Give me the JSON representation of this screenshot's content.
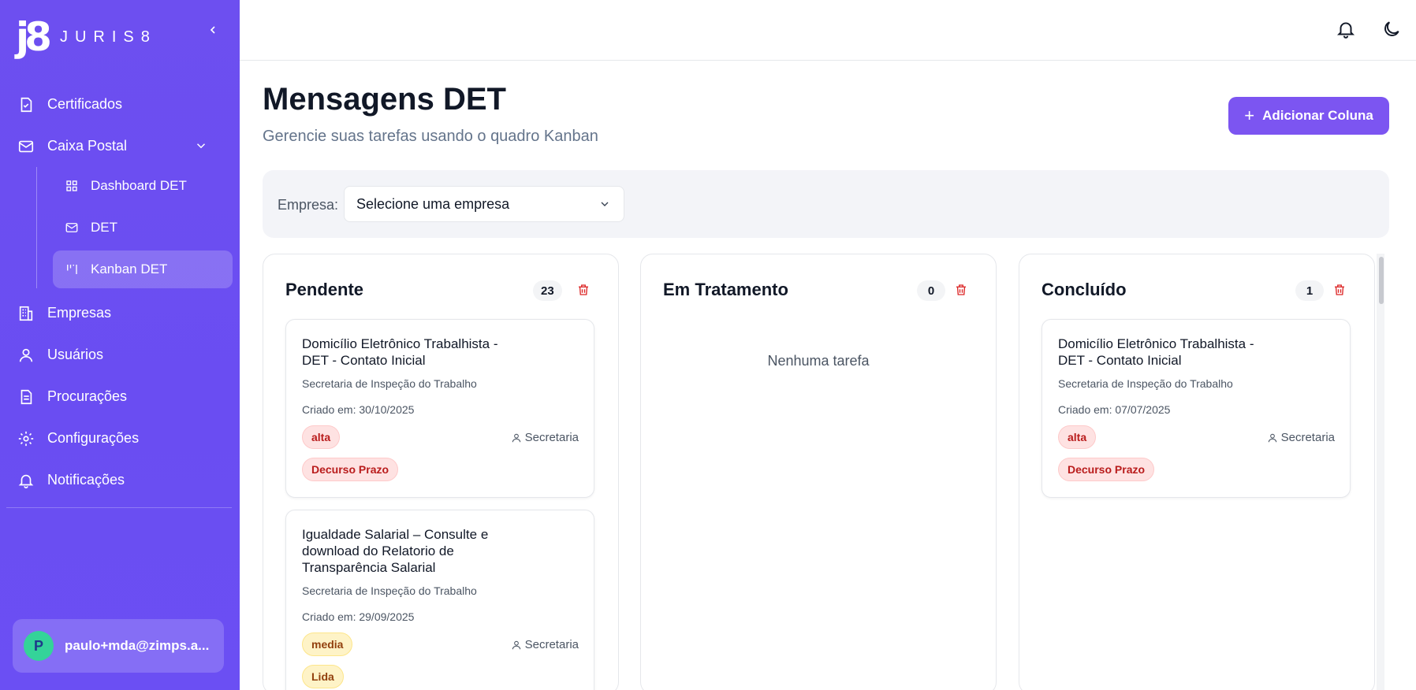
{
  "brand": {
    "mark": "j8",
    "name": "JURIS8"
  },
  "sidebar": {
    "items": [
      {
        "label": "Certificados",
        "icon": "certificate-icon"
      },
      {
        "label": "Caixa Postal",
        "icon": "mail-icon"
      },
      {
        "label": "Empresas",
        "icon": "building-icon"
      },
      {
        "label": "Usuários",
        "icon": "user-icon"
      },
      {
        "label": "Procurações",
        "icon": "document-icon"
      },
      {
        "label": "Configurações",
        "icon": "gear-icon"
      },
      {
        "label": "Notificações",
        "icon": "bell-icon"
      }
    ],
    "sub_items": [
      {
        "label": "Dashboard DET",
        "icon": "grid-icon"
      },
      {
        "label": "DET",
        "icon": "mail-icon"
      },
      {
        "label": "Kanban DET",
        "icon": "kanban-icon",
        "active": true
      }
    ],
    "user": {
      "initial": "P",
      "email": "paulo+mda@zimps.a..."
    }
  },
  "main": {
    "title": "Mensagens DET",
    "subtitle": "Gerencie suas tarefas usando o quadro Kanban",
    "add_column_label": "Adicionar Coluna",
    "filter": {
      "label": "Empresa:",
      "value": "Selecione uma empresa"
    }
  },
  "columns": [
    {
      "title": "Pendente",
      "count": "23",
      "cards": [
        {
          "title": "Domicílio Eletrônico Trabalhista - DET - Contato Inicial",
          "org": "Secretaria de Inspeção do Trabalho",
          "date": "Criado em: 30/10/2025",
          "priority": "alta",
          "assignee": "Secretaria",
          "tag": "Decurso Prazo"
        },
        {
          "title": "Igualdade Salarial – Consulte e download do Relatorio de Transparência Salarial",
          "org": "Secretaria de Inspeção do Trabalho",
          "date": "Criado em: 29/09/2025",
          "priority": "media",
          "assignee": "Secretaria",
          "tag": "Lida"
        }
      ]
    },
    {
      "title": "Em Tratamento",
      "count": "0",
      "empty_text": "Nenhuma tarefa",
      "cards": []
    },
    {
      "title": "Concluído",
      "count": "1",
      "cards": [
        {
          "title": "Domicílio Eletrônico Trabalhista - DET - Contato Inicial",
          "org": "Secretaria de Inspeção do Trabalho",
          "date": "Criado em: 07/07/2025",
          "priority": "alta",
          "assignee": "Secretaria",
          "tag": "Decurso Prazo"
        }
      ]
    }
  ],
  "colors": {
    "sidebar": "#6d4ff0",
    "accent": "#7c55f1",
    "danger": "#dc2626",
    "warning_bg": "#fef3c7"
  }
}
